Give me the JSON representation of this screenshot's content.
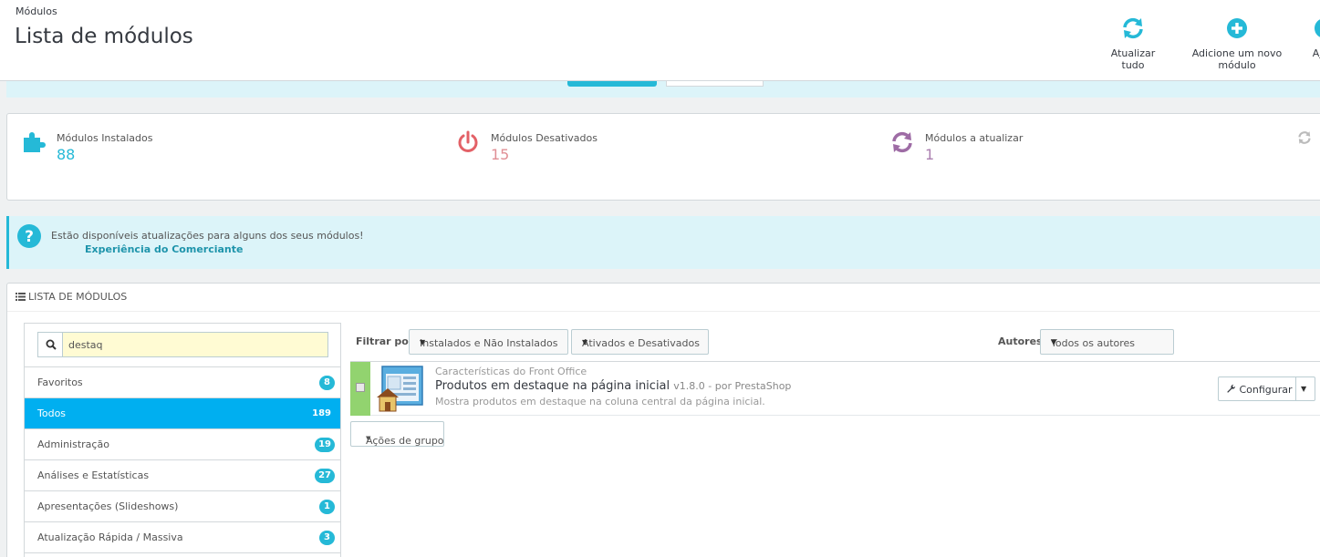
{
  "header": {
    "breadcrumb": "Módulos",
    "title": "Lista de módulos",
    "toolbar": [
      {
        "label": "Atualizar tudo",
        "icon": "refresh-icon"
      },
      {
        "label": "Adicione um novo módulo",
        "icon": "plus-circle-icon"
      },
      {
        "label": "Aj",
        "icon": "help-icon"
      }
    ]
  },
  "kpis": [
    {
      "label": "Módulos Instalados",
      "value": "88",
      "icon": "puzzle-icon",
      "color": "#25b9d7"
    },
    {
      "label": "Módulos Desativados",
      "value": "15",
      "icon": "power-icon",
      "color": "#e08f95"
    },
    {
      "label": "Módulos a atualizar",
      "value": "1",
      "icon": "refresh-icon",
      "color": "#ab7fb0"
    }
  ],
  "alert": {
    "message": "Estão disponíveis atualizações para alguns dos seus módulos!",
    "link": "Experiência do Comerciante"
  },
  "panel": {
    "heading": "Lista de Módulos",
    "search_value": "destaq",
    "categories": [
      {
        "name": "Favoritos",
        "count": "8"
      },
      {
        "name": "Todos",
        "count": "189",
        "active": true
      },
      {
        "name": "Administração",
        "count": "19"
      },
      {
        "name": "Análises e Estatísticas",
        "count": "27"
      },
      {
        "name": "Apresentações (Slideshows)",
        "count": "1"
      },
      {
        "name": "Atualização Rápida / Massiva",
        "count": "3"
      }
    ],
    "filter_label": "Filtrar por",
    "filter_install": "Instalados e Não Instalados",
    "filter_enabled": "Ativados e Desativados",
    "authors_label": "Autores",
    "authors_value": "Todos os autores",
    "module": {
      "category": "Características do Front Office",
      "name": "Produtos em destaque na página inicial",
      "version": "v1.8.0 - por PrestaShop",
      "description": "Mostra produtos em destaque na coluna central da página inicial.",
      "configure_label": "Configurar"
    },
    "group_actions_label": "Ações de grupo"
  }
}
